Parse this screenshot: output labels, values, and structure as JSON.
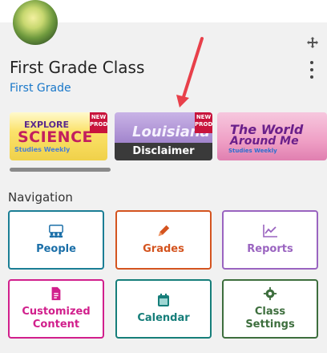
{
  "header": {
    "class_title": "First Grade Class",
    "class_subtitle": "First Grade"
  },
  "icons": {
    "move": "move-arrows-icon",
    "menu": "kebab-menu-icon"
  },
  "carousel": {
    "cards": [
      {
        "words": [
          "EXPLORE",
          "SCIENCE",
          "Studies Weekly"
        ],
        "badge": "NEW PRODUCT"
      },
      {
        "words": [
          "Louisiana"
        ],
        "badge": "NEW PRODUCT",
        "caption": "Disclaimer"
      },
      {
        "words": [
          "The World",
          "Around Me",
          "Studies Weekly"
        ]
      }
    ]
  },
  "navigation": {
    "heading": "Navigation",
    "tiles": [
      {
        "label": "People",
        "color": "#1b6fa8"
      },
      {
        "label": "Grades",
        "color": "#d4541f"
      },
      {
        "label": "Reports",
        "color": "#9a64c0"
      },
      {
        "label": "Customized Content",
        "color": "#d11f8c"
      },
      {
        "label": "Calendar",
        "color": "#167e7a"
      },
      {
        "label": "Class Settings",
        "color": "#3d6e3d"
      }
    ]
  },
  "annotation": {
    "arrow_color": "#e8404a"
  }
}
